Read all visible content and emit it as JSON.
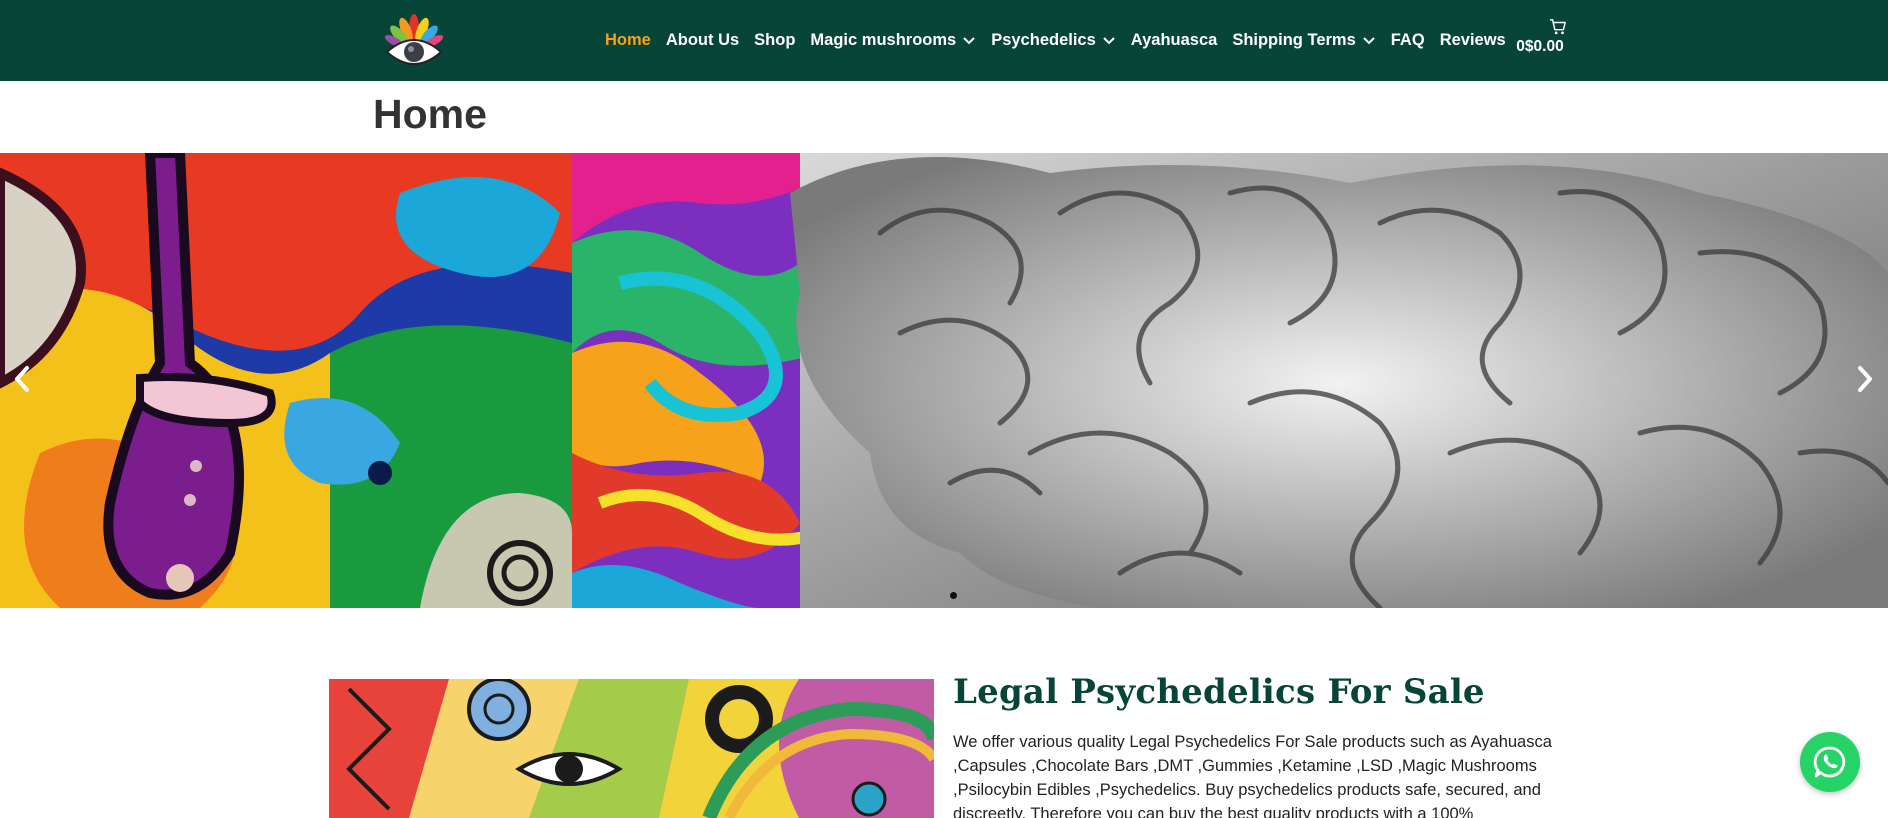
{
  "header": {
    "logo_icon": "eye-lotus-logo-icon",
    "nav": [
      {
        "label": "Home",
        "active": true,
        "dropdown": false
      },
      {
        "label": "About Us",
        "active": false,
        "dropdown": false
      },
      {
        "label": "Shop",
        "active": false,
        "dropdown": false
      },
      {
        "label": "Magic mushrooms",
        "active": false,
        "dropdown": true
      },
      {
        "label": "Psychedelics",
        "active": false,
        "dropdown": true
      },
      {
        "label": "Ayahuasca",
        "active": false,
        "dropdown": false
      },
      {
        "label": "Shipping Terms",
        "active": false,
        "dropdown": true
      },
      {
        "label": "FAQ",
        "active": false,
        "dropdown": false
      },
      {
        "label": "Reviews",
        "active": false,
        "dropdown": false
      }
    ],
    "cart": {
      "icon": "cart-icon",
      "total": "0$0.00"
    }
  },
  "page": {
    "title": "Home"
  },
  "slider": {
    "prev_icon": "chevron-left-icon",
    "next_icon": "chevron-right-icon",
    "active_dot": 1
  },
  "section": {
    "title": "Legal Psychedelics For Sale",
    "body": "We offer various quality Legal Psychedelics For Sale products such as Ayahuasca ,Capsules ,Chocolate Bars ,DMT ,Gummies ,Ketamine ,LSD ,Magic Mushrooms ,Psilocybin Edibles ,Psychedelics. Buy psychedelics products safe, secured, and discreetly. Therefore you can buy the best quality products with a 100%"
  },
  "colors": {
    "header_bg": "#064538",
    "active_nav": "#f7a21b",
    "whatsapp": "#25d366"
  },
  "whatsapp": {
    "icon": "whatsapp-icon"
  }
}
